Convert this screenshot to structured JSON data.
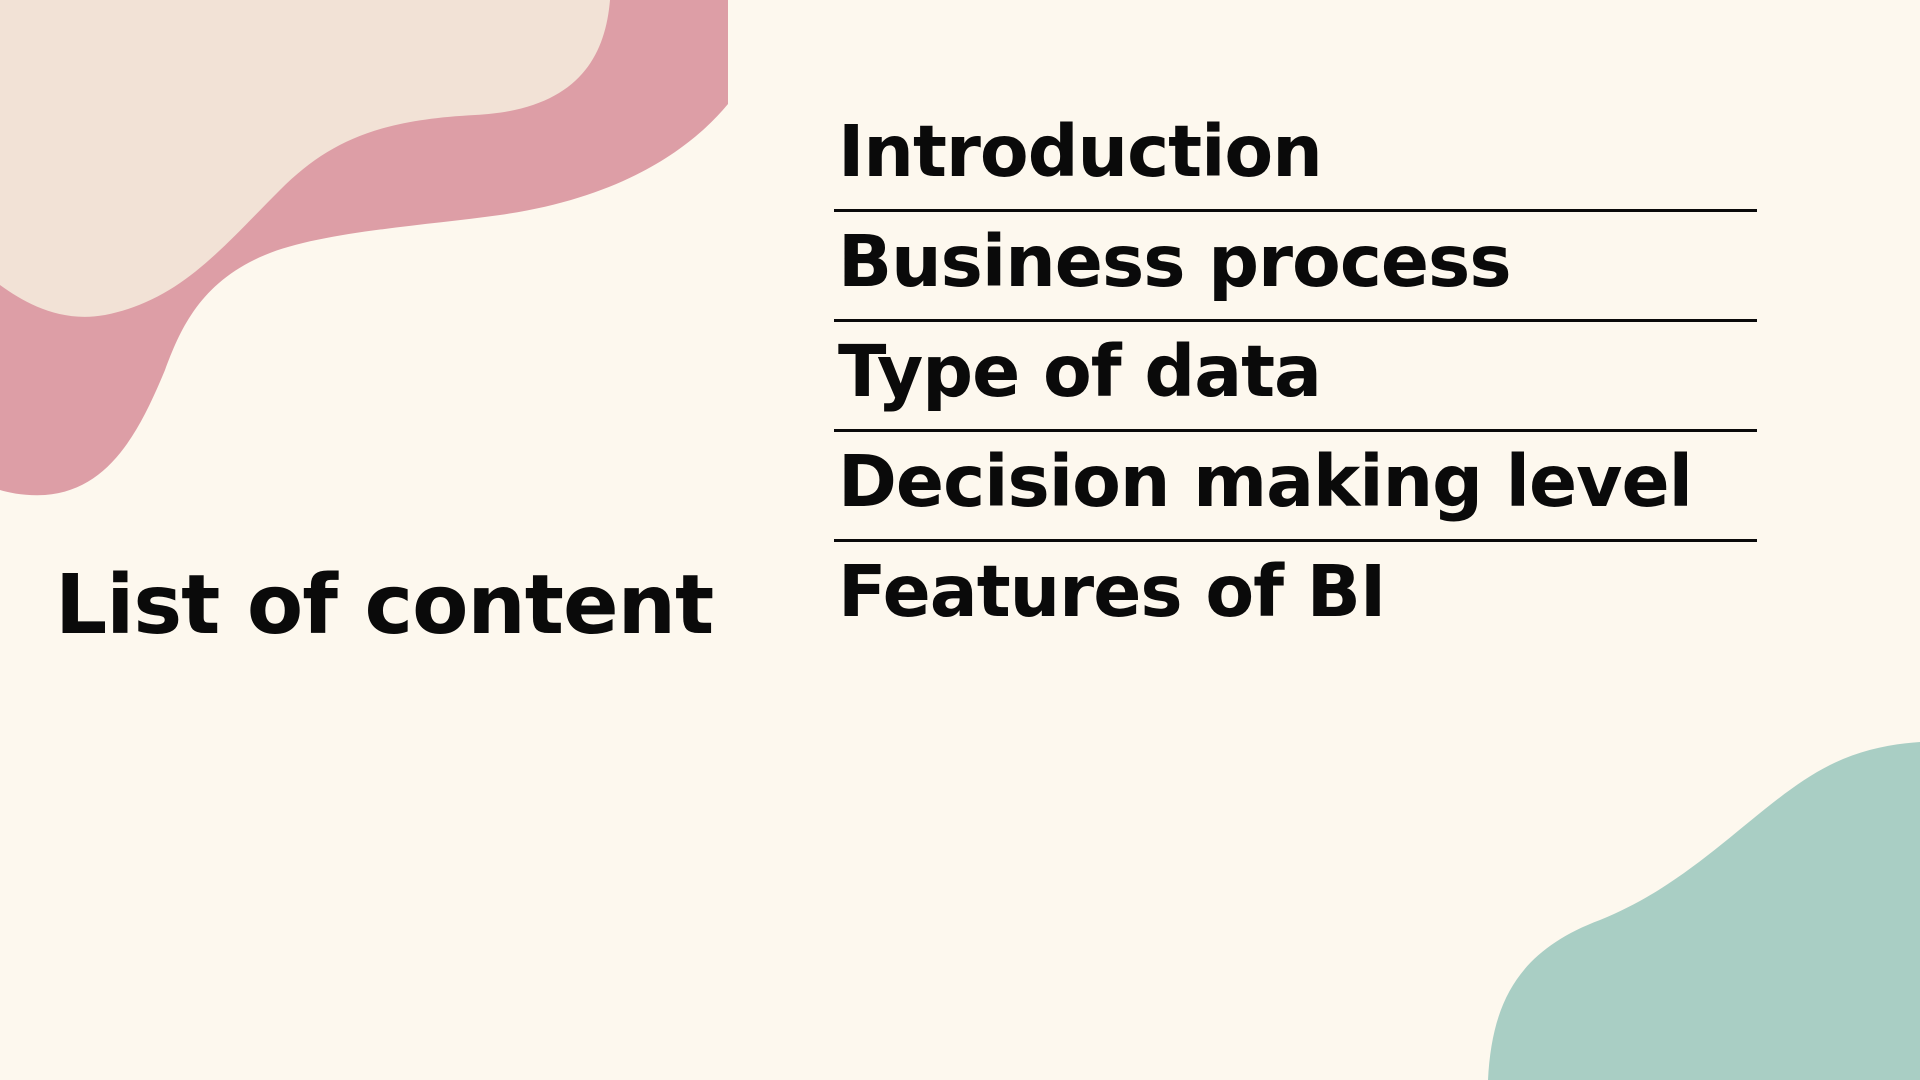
{
  "slide": {
    "title": "List of content",
    "toc_items": [
      "Introduction",
      "Business process",
      "Type of data",
      "Decision making level",
      "Features of BI"
    ]
  },
  "colors": {
    "background": "#fdf8ee",
    "beige_blob": "#f2e2d6",
    "pink_blob": "#dd9ea6",
    "teal_blob": "#a9cec4",
    "text": "#0a0a0a"
  }
}
